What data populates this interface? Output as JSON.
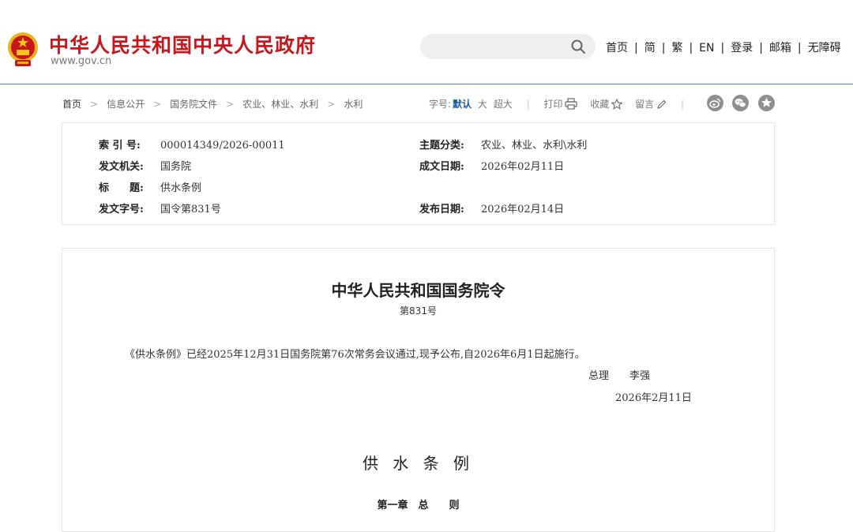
{
  "header": {
    "title": "中华人民共和国中央人民政府",
    "domain": "www.gov.cn",
    "search": {
      "placeholder": ""
    },
    "nav": {
      "home": "首页",
      "simplified": "简",
      "traditional": "繁",
      "english": "EN",
      "login": "登录",
      "mail": "邮箱",
      "accessibility": "无障碍"
    }
  },
  "breadcrumb": [
    "首页",
    "信息公开",
    "国务院文件",
    "农业、林业、水利",
    "水利"
  ],
  "tools": {
    "font_size_label": "字号:",
    "font_default": "默认",
    "font_large": "大",
    "font_xlarge": "超大",
    "print": "打印",
    "favorite": "收藏",
    "comment": "留言"
  },
  "meta": {
    "index_label": "索 引 号:",
    "index_value": "000014349/2026-00011",
    "topic_label": "主题分类:",
    "topic_value": "农业、林业、水利\\水利",
    "issuer_label": "发文机关:",
    "issuer_value": "国务院",
    "created_label": "成文日期:",
    "created_value": "2026年02月11日",
    "title_label": "标　　题:",
    "title_value": "供水条例",
    "doc_no_label": "发文字号:",
    "doc_no_value": "国令第831号",
    "published_label": "发布日期:",
    "published_value": "2026年02月14日"
  },
  "article": {
    "order_title": "中华人民共和国国务院令",
    "order_no": "第831号",
    "paragraph": "《供水条例》已经2025年12月31日国务院第76次常务会议通过,现予公布,自2026年6月1日起施行。",
    "signer_role": "总理",
    "signer_name": "李强",
    "sign_date": "2026年2月11日",
    "regulation_title": "供 水 条 例",
    "chapter_title": "第一章　总　　则"
  },
  "colors": {
    "brand_red": "#c8161d",
    "header_rule": "#4a8bc7",
    "active_font_size": "#1a5aa8"
  },
  "icons": [
    "national-emblem-icon",
    "search-icon",
    "print-icon",
    "star-icon",
    "pencil-icon",
    "weibo-icon",
    "wechat-icon",
    "qzone-icon"
  ]
}
